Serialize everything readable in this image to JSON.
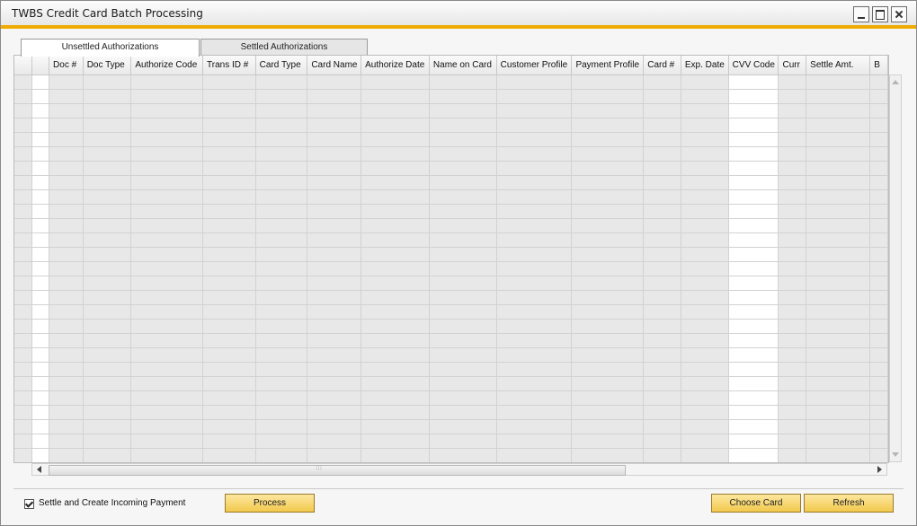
{
  "window": {
    "title": "TWBS Credit Card Batch Processing"
  },
  "tabs": [
    {
      "label": "Unsettled Authorizations",
      "active": true
    },
    {
      "label": "Settled Authorizations",
      "active": false
    }
  ],
  "grid": {
    "columns": [
      "",
      "",
      "Doc #",
      "Doc Type",
      "Authorize Code",
      "Trans ID #",
      "Card Type",
      "Card Name",
      "Authorize Date",
      "Name on Card",
      "Customer Profile",
      "Payment Profile",
      "Card #",
      "Exp. Date",
      "CVV Code",
      "Curr",
      "Settle Amt.",
      "B"
    ],
    "rows": []
  },
  "footer": {
    "settle_checkbox_label": "Settle and Create Incoming Payment",
    "settle_checked": true,
    "process_label": "Process",
    "choose_card_label": "Choose Card",
    "refresh_label": "Refresh"
  },
  "colors": {
    "accent": "#f0ab00",
    "button": "#f2c94c"
  },
  "icons": [
    "minimize-icon",
    "maximize-icon",
    "close-icon",
    "scroll-up-icon",
    "scroll-down-icon",
    "scroll-left-icon",
    "scroll-right-icon",
    "checkmark-icon"
  ]
}
